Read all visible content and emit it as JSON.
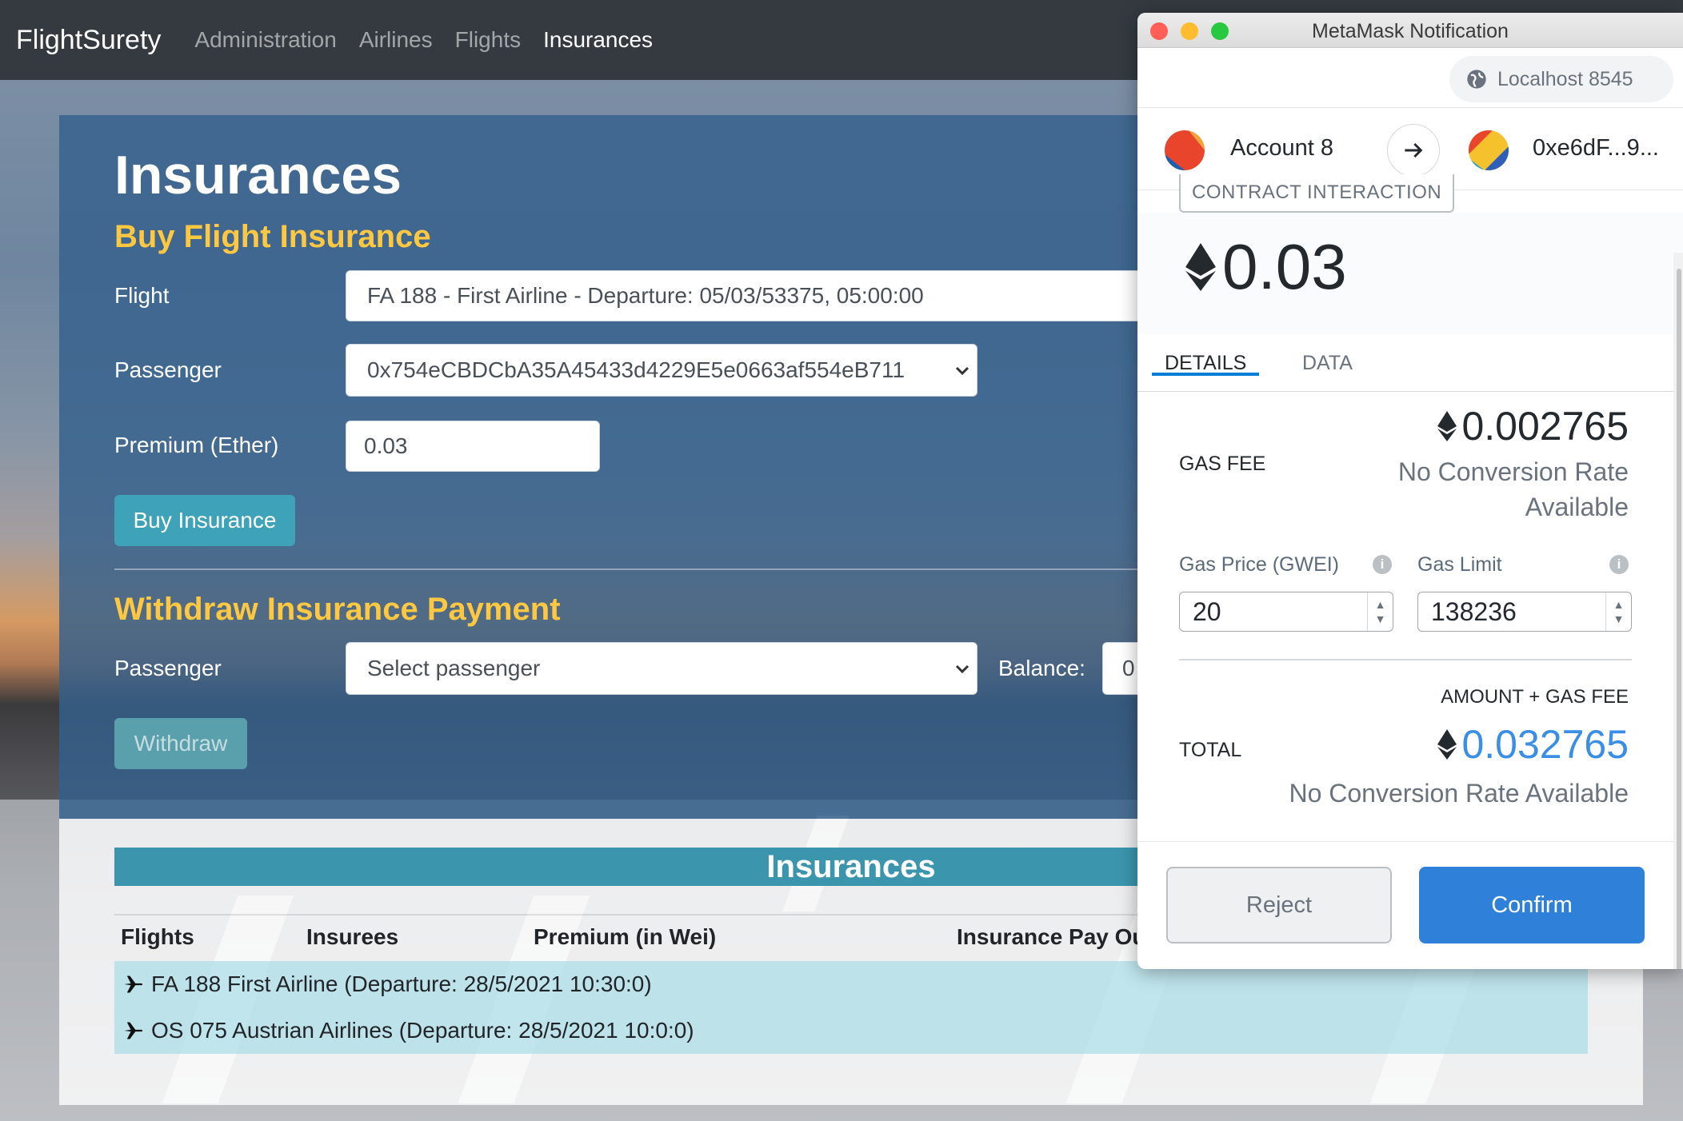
{
  "navbar": {
    "brand": "FlightSurety",
    "links": [
      "Administration",
      "Airlines",
      "Flights",
      "Insurances"
    ],
    "active": "Insurances"
  },
  "main": {
    "title": "Insurances",
    "buy": {
      "heading": "Buy Flight Insurance",
      "flight_label": "Flight",
      "flight_value": "FA 188 - First Airline - Departure: 05/03/53375, 05:00:00",
      "passenger_label": "Passenger",
      "passenger_value": "0x754eCBDCbA35A45433d4229E5e0663af554eB711",
      "premium_label": "Premium (Ether)",
      "premium_value": "0.03",
      "button": "Buy Insurance"
    },
    "withdraw": {
      "heading": "Withdraw Insurance Payment",
      "passenger_label": "Passenger",
      "passenger_value": "Select passenger",
      "balance_label": "Balance:",
      "balance_value": "0",
      "button": "Withdraw"
    }
  },
  "table": {
    "title": "Insurances",
    "headers": [
      "Flights",
      "Insurees",
      "Premium (in Wei)",
      "Insurance Pay Ou"
    ],
    "rows": [
      "FA 188 First Airline (Departure: 28/5/2021 10:30:0)",
      "OS 075 Austrian Airlines (Departure: 28/5/2021 10:0:0)"
    ]
  },
  "metamask": {
    "window_title": "MetaMask Notification",
    "network": "Localhost 8545",
    "from_account": "Account 8",
    "to_address": "0xe6dF...9...",
    "badge": "CONTRACT INTERACTION",
    "amount": "0.03",
    "tabs": [
      "DETAILS",
      "DATA"
    ],
    "active_tab": "DETAILS",
    "gas_fee_label": "GAS FEE",
    "gas_fee_value": "0.002765",
    "gas_fee_conversion_line1": "No Conversion Rate",
    "gas_fee_conversion_line2": "Available",
    "gas_price_label": "Gas Price (GWEI)",
    "gas_price_value": "20",
    "gas_limit_label": "Gas Limit",
    "gas_limit_value": "138236",
    "amount_gas_label": "AMOUNT + GAS FEE",
    "total_label": "TOTAL",
    "total_value": "0.032765",
    "total_conversion": "No Conversion Rate Available",
    "reject": "Reject",
    "confirm": "Confirm",
    "colors": {
      "confirm": "#2f80d8",
      "total": "#3a8ee6",
      "tab_underline": "#037dd6"
    }
  },
  "colors": {
    "section_heading": "#ffc840",
    "navbar": "#343a40",
    "button_info": "#3ea2b8"
  }
}
